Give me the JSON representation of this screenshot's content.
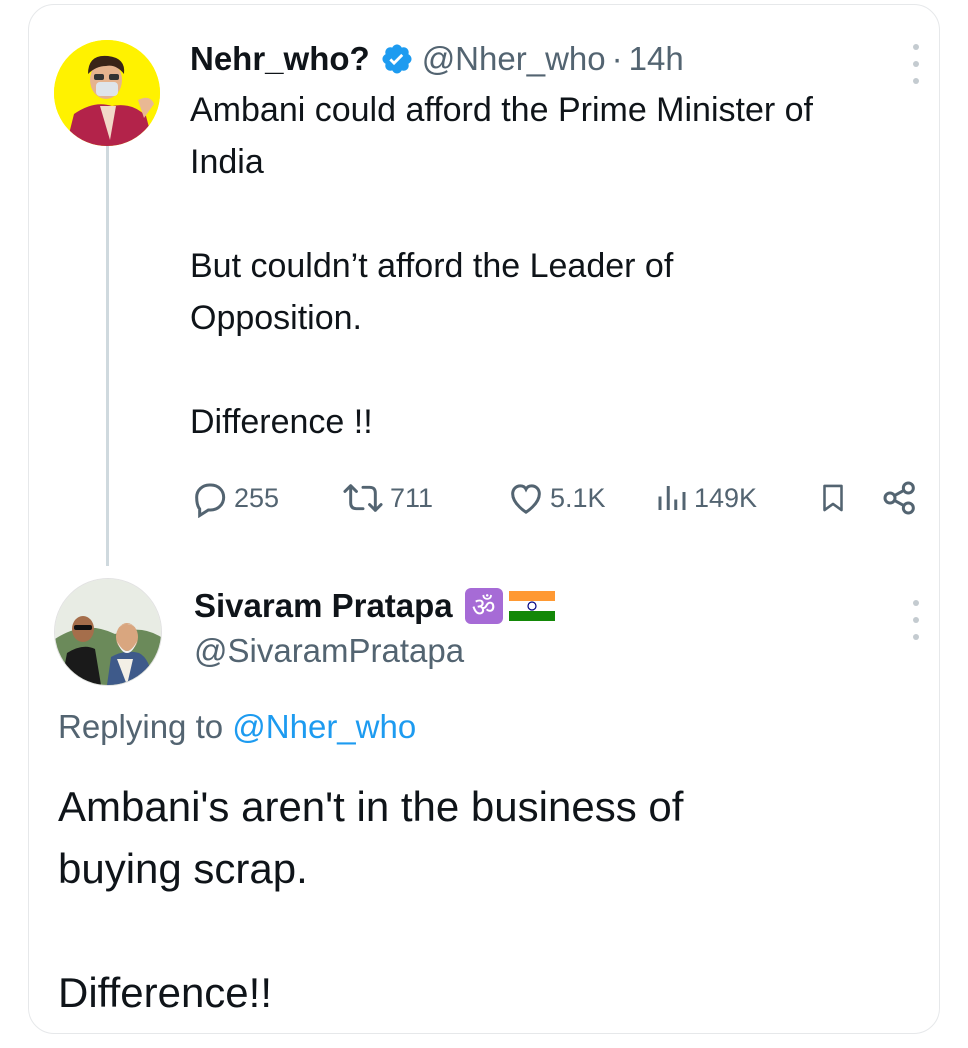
{
  "tweet1": {
    "display_name": "Nehr_who?",
    "handle": "@Nher_who",
    "separator": "·",
    "time": "14h",
    "text_line1": "Ambani could afford the Prime Minister of",
    "text_line2": "India",
    "text_line3": "But couldn’t afford the Leader of",
    "text_line4": "Opposition.",
    "text_line5": "Difference !!",
    "stats": {
      "replies": "255",
      "reposts": "711",
      "likes": "5.1K",
      "views": "149K"
    },
    "avatar_bg": "#fff200"
  },
  "tweet2": {
    "display_name": "Sivaram Pratapa",
    "om_symbol": "ॐ",
    "handle": "@SivaramPratapa",
    "replying_prefix": "Replying to",
    "replying_to": "@Nher_who",
    "text_line1": "Ambani's aren't in the business of",
    "text_line2": "buying scrap.",
    "text_line3": "Difference!!"
  },
  "icons": {
    "verified": "verified-badge-icon",
    "reply": "reply-icon",
    "repost": "repost-icon",
    "like": "heart-icon",
    "views": "views-icon",
    "bookmark": "bookmark-icon",
    "share": "share-icon",
    "more": "more-icon"
  },
  "colors": {
    "verified_blue": "#1d9bf0",
    "link_blue": "#1d9bf0",
    "muted_text": "#536471",
    "om_badge": "#a66bd6"
  }
}
